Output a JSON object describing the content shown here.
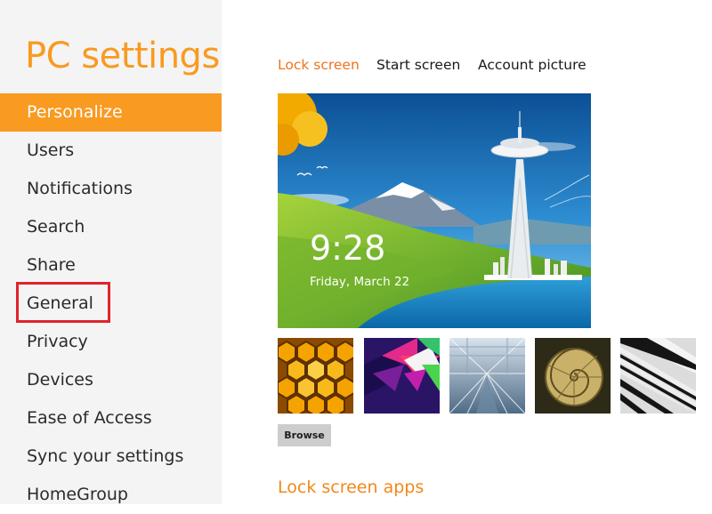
{
  "app": {
    "title": "PC settings"
  },
  "sidebar": {
    "items": [
      {
        "label": "Personalize",
        "selected": true
      },
      {
        "label": "Users"
      },
      {
        "label": "Notifications"
      },
      {
        "label": "Search"
      },
      {
        "label": "Share"
      },
      {
        "label": "General"
      },
      {
        "label": "Privacy"
      },
      {
        "label": "Devices"
      },
      {
        "label": "Ease of Access"
      },
      {
        "label": "Sync your settings"
      },
      {
        "label": "HomeGroup"
      }
    ]
  },
  "tabs": [
    {
      "label": "Lock screen",
      "active": true
    },
    {
      "label": "Start screen"
    },
    {
      "label": "Account picture"
    }
  ],
  "lock_screen": {
    "time": "9:28",
    "date": "Friday, March 22",
    "thumbnails": [
      "honeycomb",
      "geometric-prism",
      "train-tunnel",
      "nautilus-shell",
      "piano-keys"
    ]
  },
  "browse_label": "Browse",
  "lock_screen_apps_heading": "Lock screen apps",
  "colors": {
    "accent": "#f99a21",
    "active_tab": "#f0731c",
    "sidebar_bg": "#f4f4f4",
    "annotation": "#e0232c"
  }
}
